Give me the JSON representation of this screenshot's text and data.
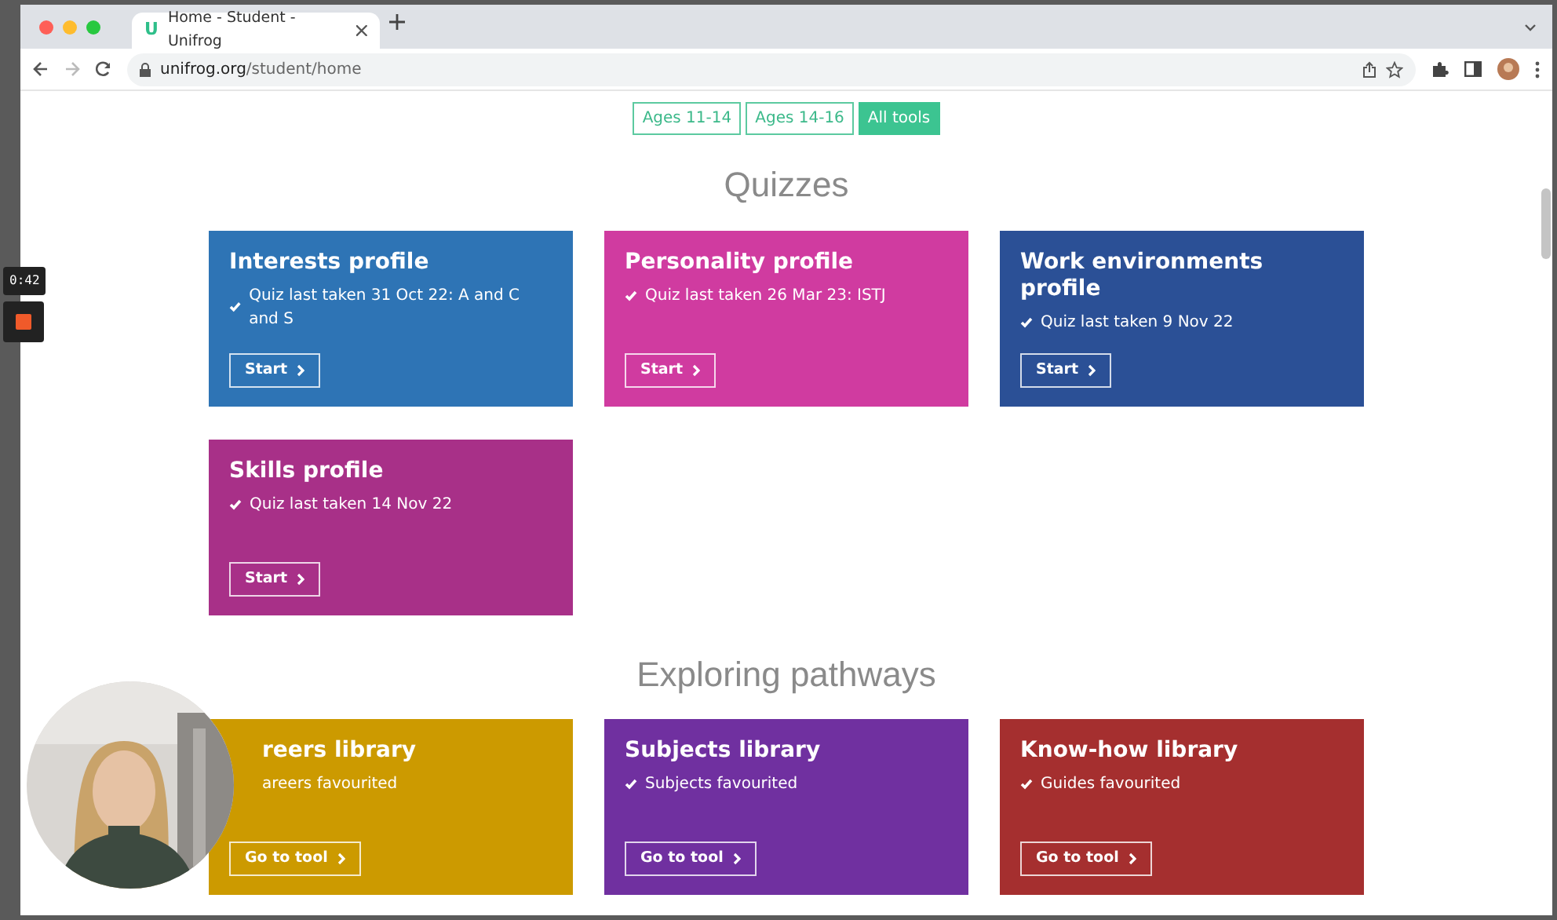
{
  "window": {
    "tab_icon": "U",
    "tab_title": "Home - Student - Unifrog",
    "url_host": "unifrog.org",
    "url_path": "/student/home"
  },
  "recorder": {
    "time": "0:42"
  },
  "filters": [
    {
      "label": "Ages 11-14",
      "selected": false
    },
    {
      "label": "Ages 14-16",
      "selected": false
    },
    {
      "label": "All tools",
      "selected": true
    }
  ],
  "sections": [
    {
      "heading": "Quizzes",
      "cards": [
        {
          "title": "Interests profile",
          "detail": "Quiz last taken 31 Oct 22: A and C and S",
          "tick": true,
          "button": "Start",
          "color": "#2e74b5"
        },
        {
          "title": "Personality profile",
          "detail": "Quiz last taken 26 Mar 23: ISTJ",
          "tick": true,
          "button": "Start",
          "color": "#d03ba0"
        },
        {
          "title": "Work environments profile",
          "detail": "Quiz last taken 9 Nov 22",
          "tick": true,
          "button": "Start",
          "color": "#2b5096"
        },
        {
          "title": "Skills profile",
          "detail": "Quiz last taken 14 Nov 22",
          "tick": true,
          "button": "Start",
          "color": "#a83088"
        }
      ]
    },
    {
      "heading": "Exploring pathways",
      "cards": [
        {
          "title": "reers library",
          "detail": "areers favourited",
          "tick": false,
          "button": "Go to tool",
          "color": "#cc9a00"
        },
        {
          "title": "Subjects library",
          "detail": "Subjects favourited",
          "tick": true,
          "button": "Go to tool",
          "color": "#7030a0"
        },
        {
          "title": "Know-how library",
          "detail": "Guides favourited",
          "tick": true,
          "button": "Go to tool",
          "color": "#a52f2f"
        }
      ]
    }
  ]
}
